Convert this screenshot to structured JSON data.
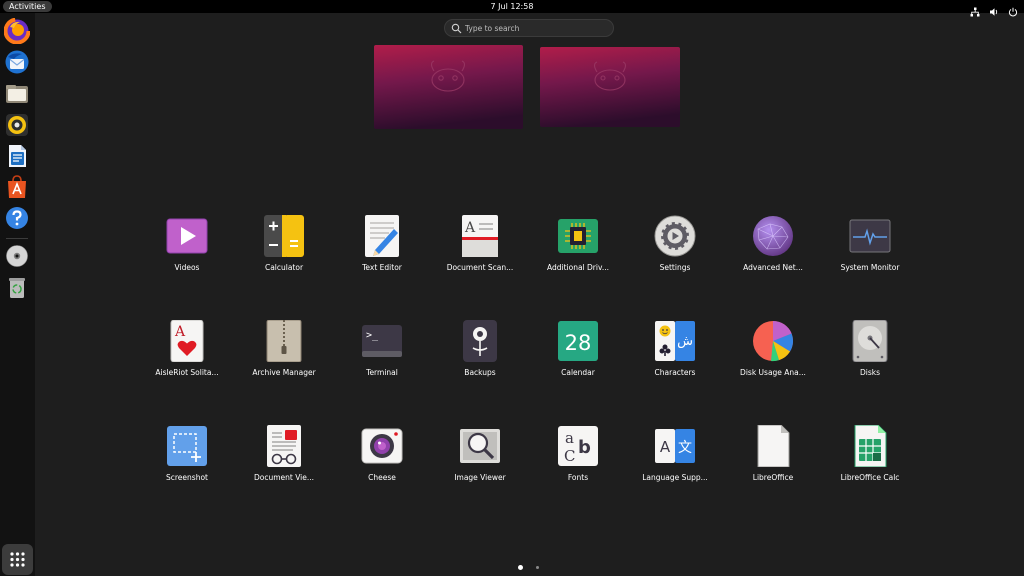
{
  "topbar": {
    "activities": "Activities",
    "clock": "7 Jul  12:58"
  },
  "tray": [
    "network-icon",
    "volume-icon",
    "power-icon"
  ],
  "search": {
    "placeholder": "Type to search",
    "value": ""
  },
  "dock": {
    "items": [
      "Firefox",
      "Thunderbird Mail",
      "Files",
      "Rhythmbox",
      "LibreOffice Writer",
      "Ubuntu Software",
      "Help"
    ],
    "extras": [
      "Disc",
      "Trash"
    ]
  },
  "apps": [
    {
      "label": "Videos"
    },
    {
      "label": "Calculator"
    },
    {
      "label": "Text Editor"
    },
    {
      "label": "Document Scan..."
    },
    {
      "label": "Additional Driv..."
    },
    {
      "label": "Settings"
    },
    {
      "label": "Advanced Net..."
    },
    {
      "label": "System Monitor"
    },
    {
      "label": "AisleRiot Solita..."
    },
    {
      "label": "Archive Manager"
    },
    {
      "label": "Terminal"
    },
    {
      "label": "Backups"
    },
    {
      "label": "Calendar"
    },
    {
      "label": "Characters"
    },
    {
      "label": "Disk Usage Ana..."
    },
    {
      "label": "Disks"
    },
    {
      "label": "Screenshot"
    },
    {
      "label": "Document Vie..."
    },
    {
      "label": "Cheese"
    },
    {
      "label": "Image Viewer"
    },
    {
      "label": "Fonts"
    },
    {
      "label": "Language Supp..."
    },
    {
      "label": "LibreOffice"
    },
    {
      "label": "LibreOffice Calc"
    }
  ],
  "icon_text": {
    "calendar": "28",
    "fonts_a": "a",
    "fonts_c": "C",
    "fonts_b": "b",
    "lang_a": "A",
    "lang_zh": "文",
    "characters_ar": "ش",
    "solitaire": "A",
    "doc_scan": "A",
    "terminal": ">_"
  },
  "pages": {
    "current": 1,
    "total": 2
  },
  "colors": {
    "accent": "#e95420",
    "wallpaper_top": "#b11d4a",
    "wallpaper_bottom": "#2c0d2b"
  }
}
